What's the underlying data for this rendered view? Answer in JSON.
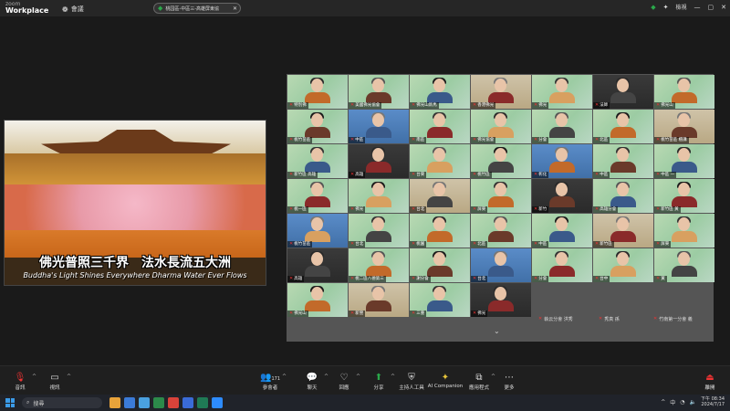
{
  "app": {
    "brand_top": "zoom",
    "brand_bottom": "Workplace",
    "meeting_label": "會議"
  },
  "title_pill": {
    "text": "桃园區-中區三-高雄屏東協"
  },
  "topright": {
    "view_label": "檢視",
    "icons": [
      "shield-icon",
      "sparkle-icon",
      "minimize-icon",
      "maximize-icon",
      "close-icon"
    ]
  },
  "share": {
    "caption_zh": "佛光普照三千界　法水長流五大洲",
    "caption_en": "Buddha's Light Shines Everywhere Dharma Water Ever Flows"
  },
  "gallery": {
    "tiles": [
      {
        "name": "特別佛"
      },
      {
        "name": "美國佛光協會"
      },
      {
        "name": "佛光山新馬"
      },
      {
        "name": "香港佛光"
      },
      {
        "name": "佛光"
      },
      {
        "name": "法師"
      },
      {
        "name": "佛光山"
      },
      {
        "name": "桃竹苗區"
      },
      {
        "name": "中區"
      },
      {
        "name": "南區"
      },
      {
        "name": "佛光協會"
      },
      {
        "name": "分會"
      },
      {
        "name": "北區"
      },
      {
        "name": "桃竹苗區 檀講"
      },
      {
        "name": "新竹區 高雄"
      },
      {
        "name": "高雄"
      },
      {
        "name": "台東"
      },
      {
        "name": "桃竹區"
      },
      {
        "name": "彰化"
      },
      {
        "name": "中區"
      },
      {
        "name": "中區 一"
      },
      {
        "name": "桃一區"
      },
      {
        "name": "佛光"
      },
      {
        "name": "台北"
      },
      {
        "name": "屏東"
      },
      {
        "name": "新竹"
      },
      {
        "name": "高雄分會"
      },
      {
        "name": "新竹區 黃"
      },
      {
        "name": "桃竹苗區"
      },
      {
        "name": "台北"
      },
      {
        "name": "桃園"
      },
      {
        "name": "北區"
      },
      {
        "name": "中區"
      },
      {
        "name": "新竹區"
      },
      {
        "name": "屏東"
      },
      {
        "name": "高雄"
      },
      {
        "name": "桃二區八德第三"
      },
      {
        "name": "謝分會"
      },
      {
        "name": "台北"
      },
      {
        "name": "分會"
      },
      {
        "name": "台中"
      },
      {
        "name": "黃"
      },
      {
        "name": "佛光山"
      },
      {
        "name": "新營"
      },
      {
        "name": "三重"
      },
      {
        "name": "佛光"
      }
    ],
    "bottom_names": [
      "執云分會 洪秀",
      "秀真 孫",
      "竹南第一分會 義"
    ],
    "pager": "⌄"
  },
  "toolbar": {
    "items": [
      {
        "label": "音訊",
        "icon": "mic-muted-icon"
      },
      {
        "label": "視訊",
        "icon": "video-icon"
      },
      {
        "label": "參會者",
        "icon": "participants-icon",
        "count": "171"
      },
      {
        "label": "聊天",
        "icon": "chat-icon"
      },
      {
        "label": "回應",
        "icon": "heart-icon"
      },
      {
        "label": "分享",
        "icon": "share-icon"
      },
      {
        "label": "主持人工具",
        "icon": "shield-tools-icon"
      },
      {
        "label": "AI Companion",
        "icon": "ai-sparkle-icon"
      },
      {
        "label": "應用程式",
        "icon": "apps-icon"
      },
      {
        "label": "更多",
        "icon": "more-icon"
      },
      {
        "label": "離開",
        "icon": "leave-icon"
      }
    ]
  },
  "taskbar": {
    "search_placeholder": "搜尋",
    "ime": "中",
    "time": "下午 08:34",
    "date": "2024/7/17"
  }
}
